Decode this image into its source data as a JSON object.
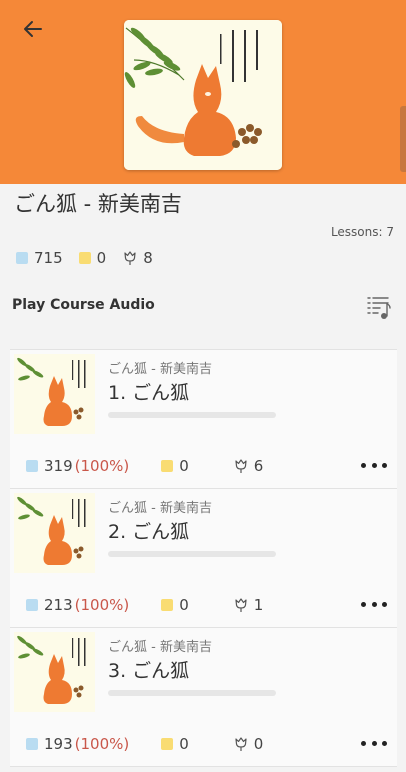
{
  "course": {
    "title": "ごん狐 - 新美南吉",
    "lessons_count": "Lessons: 7",
    "stats": {
      "blue": "715",
      "yellow": "0",
      "tulip": "8"
    },
    "cover_icon": "book-cover-fox-image"
  },
  "audio": {
    "label": "Play Course Audio",
    "icon": "playlist-music-icon"
  },
  "lessons": [
    {
      "course": "ごん狐 - 新美南吉",
      "title": "1. ごん狐",
      "blue": "319",
      "pct": "(100%)",
      "yellow": "0",
      "tulip": "6",
      "progress": 0
    },
    {
      "course": "ごん狐 - 新美南吉",
      "title": "2. ごん狐",
      "blue": "213",
      "pct": "(100%)",
      "yellow": "0",
      "tulip": "1",
      "progress": 0
    },
    {
      "course": "ごん狐 - 新美南吉",
      "title": "3. ごん狐",
      "blue": "193",
      "pct": "(100%)",
      "yellow": "0",
      "tulip": "0",
      "progress": 0
    }
  ],
  "colors": {
    "header": "#f58838",
    "blue": "#b9dcf1",
    "yellow": "#f9dc72",
    "percent": "#c9574a"
  }
}
